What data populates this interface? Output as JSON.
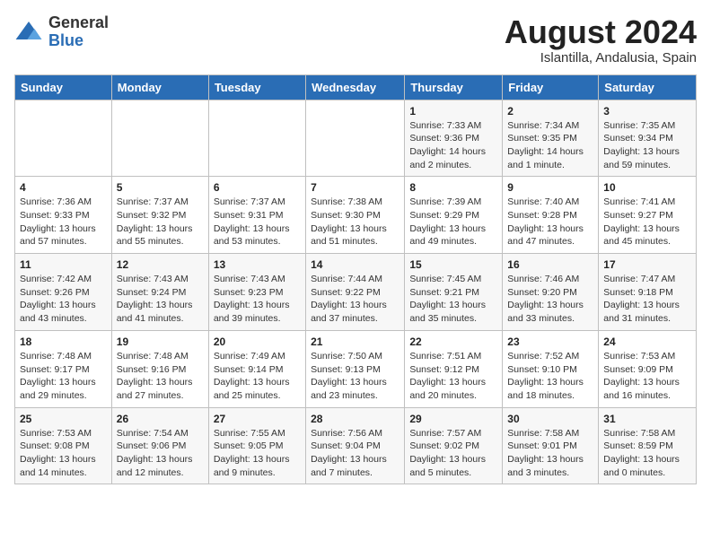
{
  "logo": {
    "general": "General",
    "blue": "Blue"
  },
  "title": "August 2024",
  "location": "Islantilla, Andalusia, Spain",
  "days_of_week": [
    "Sunday",
    "Monday",
    "Tuesday",
    "Wednesday",
    "Thursday",
    "Friday",
    "Saturday"
  ],
  "weeks": [
    [
      {
        "day": "",
        "info": ""
      },
      {
        "day": "",
        "info": ""
      },
      {
        "day": "",
        "info": ""
      },
      {
        "day": "",
        "info": ""
      },
      {
        "day": "1",
        "info": "Sunrise: 7:33 AM\nSunset: 9:36 PM\nDaylight: 14 hours\nand 2 minutes."
      },
      {
        "day": "2",
        "info": "Sunrise: 7:34 AM\nSunset: 9:35 PM\nDaylight: 14 hours\nand 1 minute."
      },
      {
        "day": "3",
        "info": "Sunrise: 7:35 AM\nSunset: 9:34 PM\nDaylight: 13 hours\nand 59 minutes."
      }
    ],
    [
      {
        "day": "4",
        "info": "Sunrise: 7:36 AM\nSunset: 9:33 PM\nDaylight: 13 hours\nand 57 minutes."
      },
      {
        "day": "5",
        "info": "Sunrise: 7:37 AM\nSunset: 9:32 PM\nDaylight: 13 hours\nand 55 minutes."
      },
      {
        "day": "6",
        "info": "Sunrise: 7:37 AM\nSunset: 9:31 PM\nDaylight: 13 hours\nand 53 minutes."
      },
      {
        "day": "7",
        "info": "Sunrise: 7:38 AM\nSunset: 9:30 PM\nDaylight: 13 hours\nand 51 minutes."
      },
      {
        "day": "8",
        "info": "Sunrise: 7:39 AM\nSunset: 9:29 PM\nDaylight: 13 hours\nand 49 minutes."
      },
      {
        "day": "9",
        "info": "Sunrise: 7:40 AM\nSunset: 9:28 PM\nDaylight: 13 hours\nand 47 minutes."
      },
      {
        "day": "10",
        "info": "Sunrise: 7:41 AM\nSunset: 9:27 PM\nDaylight: 13 hours\nand 45 minutes."
      }
    ],
    [
      {
        "day": "11",
        "info": "Sunrise: 7:42 AM\nSunset: 9:26 PM\nDaylight: 13 hours\nand 43 minutes."
      },
      {
        "day": "12",
        "info": "Sunrise: 7:43 AM\nSunset: 9:24 PM\nDaylight: 13 hours\nand 41 minutes."
      },
      {
        "day": "13",
        "info": "Sunrise: 7:43 AM\nSunset: 9:23 PM\nDaylight: 13 hours\nand 39 minutes."
      },
      {
        "day": "14",
        "info": "Sunrise: 7:44 AM\nSunset: 9:22 PM\nDaylight: 13 hours\nand 37 minutes."
      },
      {
        "day": "15",
        "info": "Sunrise: 7:45 AM\nSunset: 9:21 PM\nDaylight: 13 hours\nand 35 minutes."
      },
      {
        "day": "16",
        "info": "Sunrise: 7:46 AM\nSunset: 9:20 PM\nDaylight: 13 hours\nand 33 minutes."
      },
      {
        "day": "17",
        "info": "Sunrise: 7:47 AM\nSunset: 9:18 PM\nDaylight: 13 hours\nand 31 minutes."
      }
    ],
    [
      {
        "day": "18",
        "info": "Sunrise: 7:48 AM\nSunset: 9:17 PM\nDaylight: 13 hours\nand 29 minutes."
      },
      {
        "day": "19",
        "info": "Sunrise: 7:48 AM\nSunset: 9:16 PM\nDaylight: 13 hours\nand 27 minutes."
      },
      {
        "day": "20",
        "info": "Sunrise: 7:49 AM\nSunset: 9:14 PM\nDaylight: 13 hours\nand 25 minutes."
      },
      {
        "day": "21",
        "info": "Sunrise: 7:50 AM\nSunset: 9:13 PM\nDaylight: 13 hours\nand 23 minutes."
      },
      {
        "day": "22",
        "info": "Sunrise: 7:51 AM\nSunset: 9:12 PM\nDaylight: 13 hours\nand 20 minutes."
      },
      {
        "day": "23",
        "info": "Sunrise: 7:52 AM\nSunset: 9:10 PM\nDaylight: 13 hours\nand 18 minutes."
      },
      {
        "day": "24",
        "info": "Sunrise: 7:53 AM\nSunset: 9:09 PM\nDaylight: 13 hours\nand 16 minutes."
      }
    ],
    [
      {
        "day": "25",
        "info": "Sunrise: 7:53 AM\nSunset: 9:08 PM\nDaylight: 13 hours\nand 14 minutes."
      },
      {
        "day": "26",
        "info": "Sunrise: 7:54 AM\nSunset: 9:06 PM\nDaylight: 13 hours\nand 12 minutes."
      },
      {
        "day": "27",
        "info": "Sunrise: 7:55 AM\nSunset: 9:05 PM\nDaylight: 13 hours\nand 9 minutes."
      },
      {
        "day": "28",
        "info": "Sunrise: 7:56 AM\nSunset: 9:04 PM\nDaylight: 13 hours\nand 7 minutes."
      },
      {
        "day": "29",
        "info": "Sunrise: 7:57 AM\nSunset: 9:02 PM\nDaylight: 13 hours\nand 5 minutes."
      },
      {
        "day": "30",
        "info": "Sunrise: 7:58 AM\nSunset: 9:01 PM\nDaylight: 13 hours\nand 3 minutes."
      },
      {
        "day": "31",
        "info": "Sunrise: 7:58 AM\nSunset: 8:59 PM\nDaylight: 13 hours\nand 0 minutes."
      }
    ]
  ]
}
